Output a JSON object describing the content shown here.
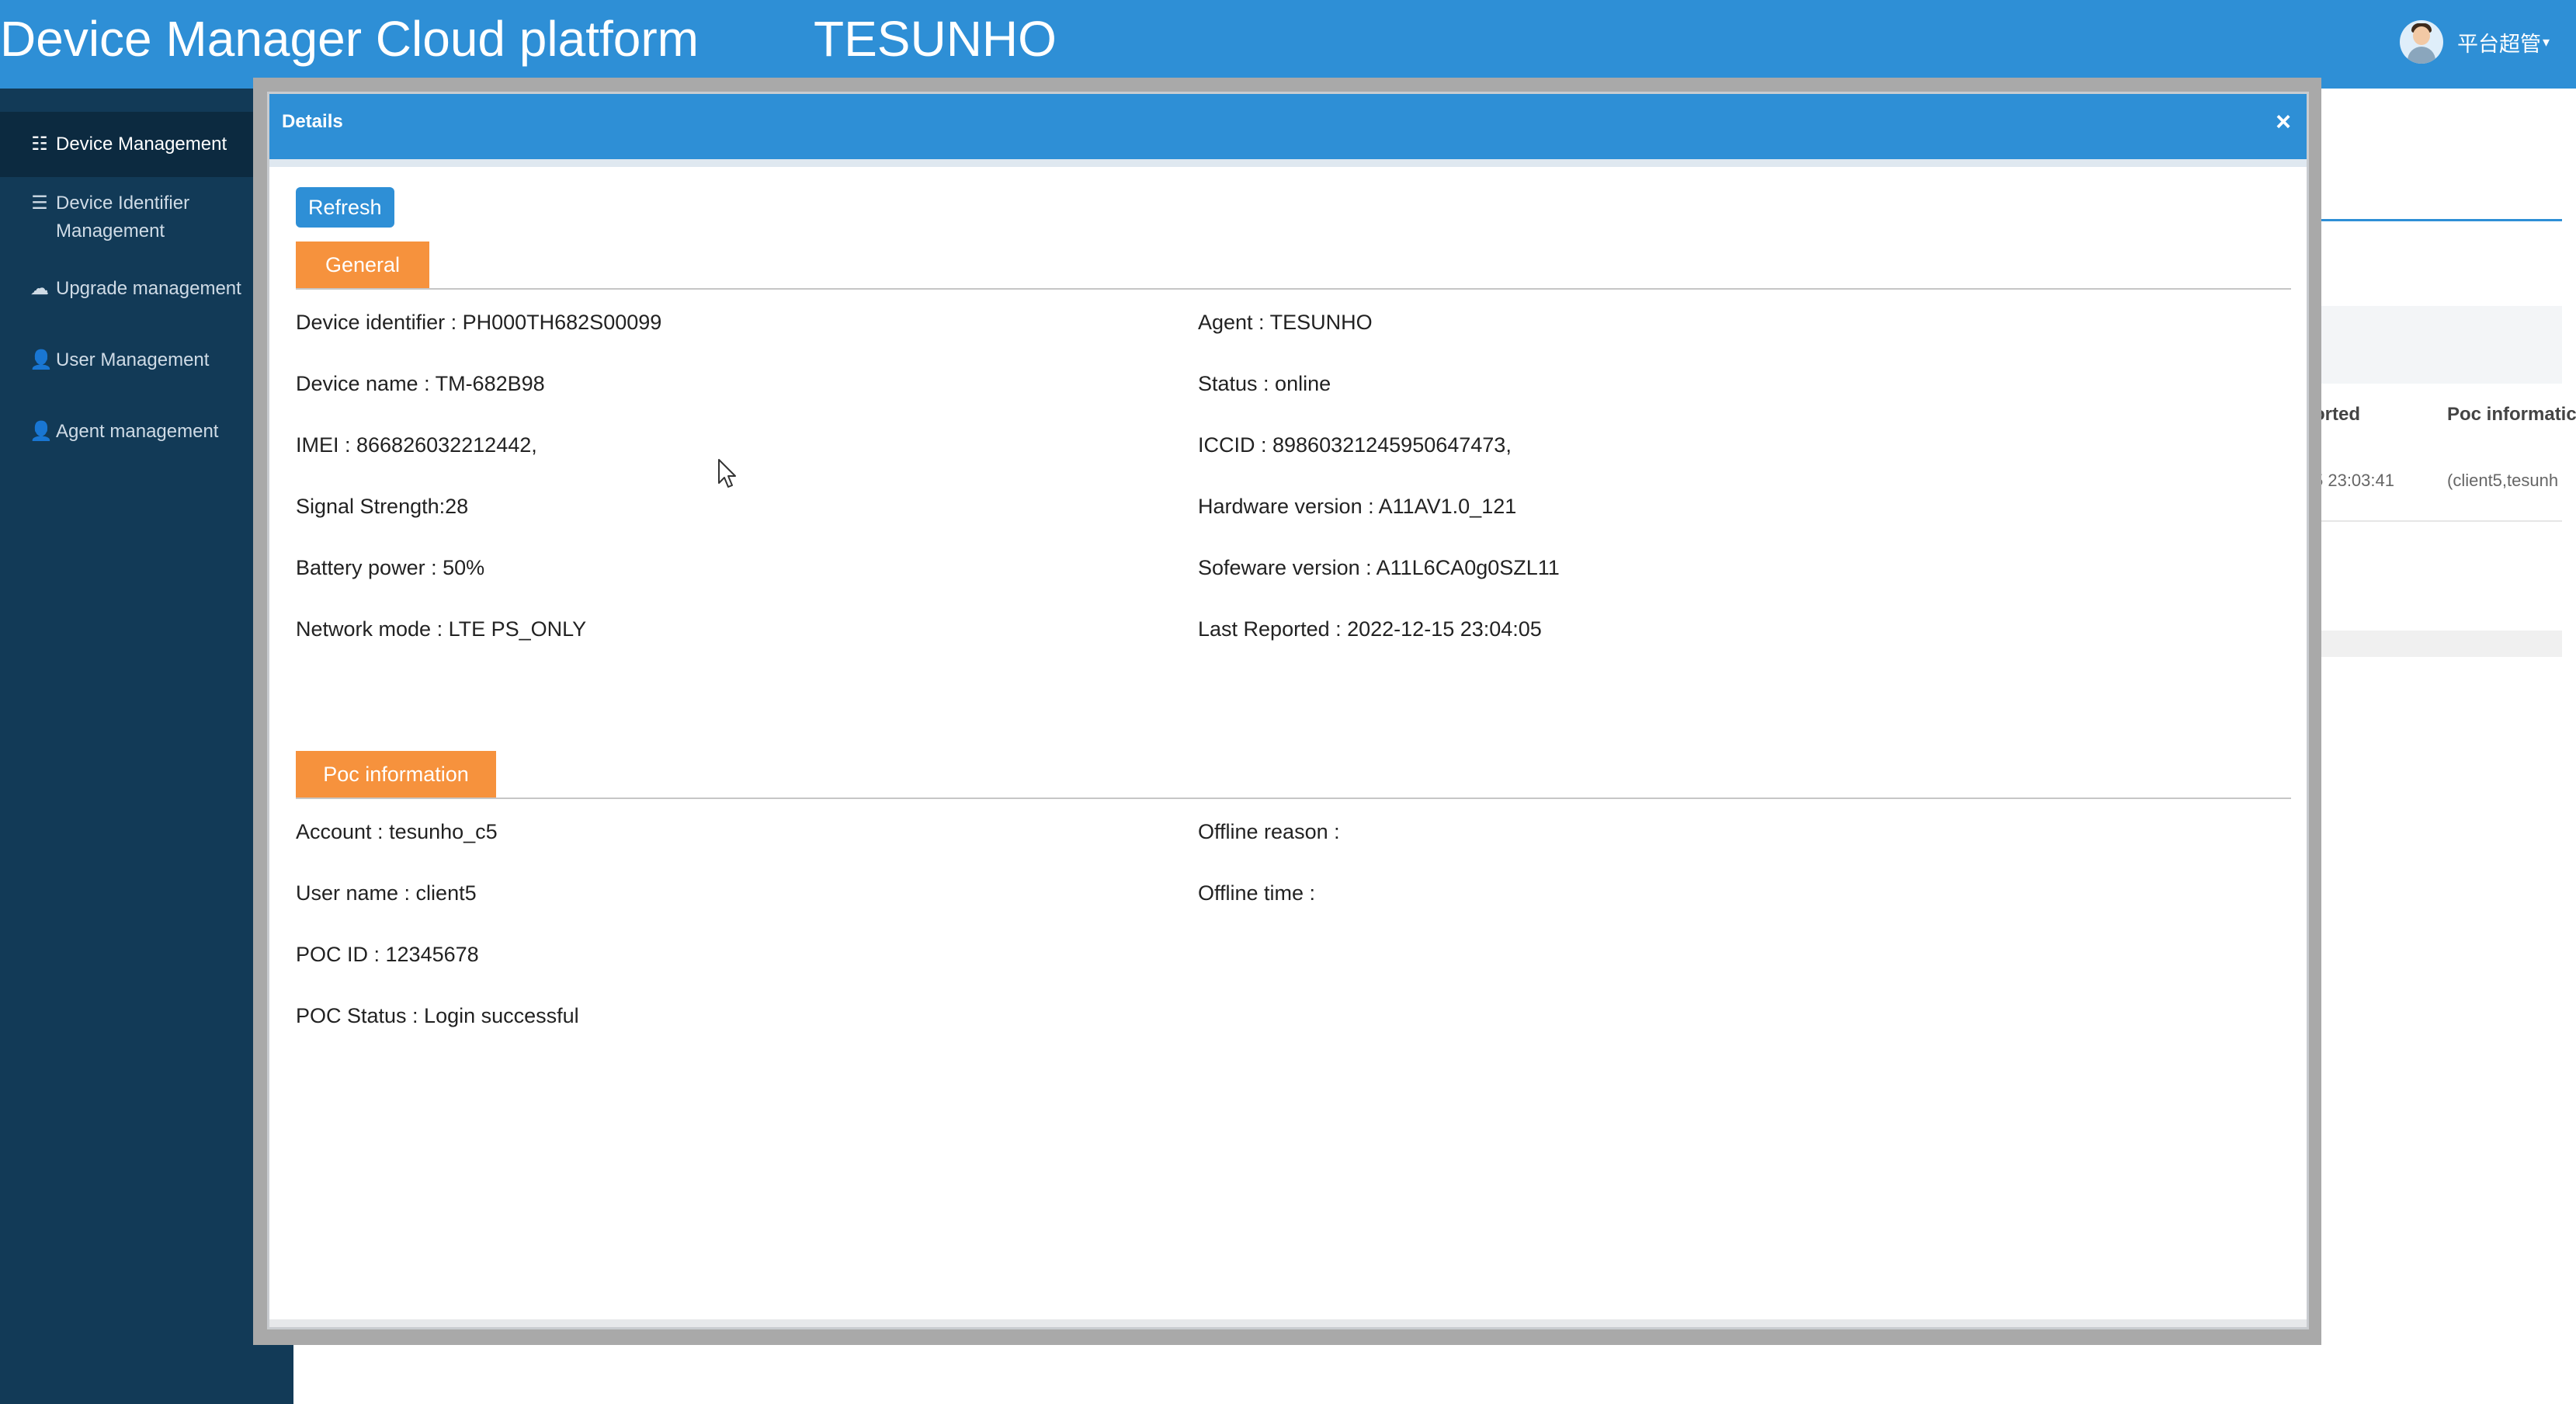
{
  "header": {
    "app_title": "Device Manager Cloud platform",
    "brand": "TESUNHO",
    "user_label": "平台超管",
    "user_caret": "▾"
  },
  "sidebar": {
    "items": [
      {
        "label": "Device Management",
        "icon": "grid-icon",
        "glyph": "☷",
        "active": true
      },
      {
        "label": "Device Identifier Management",
        "icon": "list-icon",
        "glyph": "☰",
        "active": false
      },
      {
        "label": "Upgrade management",
        "icon": "cloud-upload-icon",
        "glyph": "☁",
        "active": false
      },
      {
        "label": "User Management",
        "icon": "user-icon",
        "glyph": "👤",
        "active": false
      },
      {
        "label": "Agent management",
        "icon": "user-icon",
        "glyph": "👤",
        "active": false
      }
    ]
  },
  "background": {
    "column_reported": "orted",
    "column_poc": "Poc informatic",
    "cell_time": "5 23:03:41",
    "cell_poc": "(client5,tesunh"
  },
  "modal": {
    "title": "Details",
    "close_glyph": "×",
    "refresh_label": "Refresh",
    "general": {
      "tab_label": "General",
      "left": [
        "Device identifier : PH000TH682S00099",
        "Device name : TM-682B98",
        "IMEI : 866826032212442,",
        "Signal Strength:28",
        "Battery power : 50%",
        "Network mode : LTE PS_ONLY"
      ],
      "right": [
        "Agent : TESUNHO",
        "Status : online",
        "ICCID : 89860321245950647473,",
        "Hardware version : A11AV1.0_121",
        "Sofeware version : A11L6CA0g0SZL11",
        "Last Reported : 2022-12-15 23:04:05"
      ]
    },
    "poc": {
      "tab_label": "Poc information",
      "left": [
        "Account : tesunho_c5",
        "User name : client5",
        "POC ID : 12345678",
        "POC Status : Login successful"
      ],
      "right": [
        "Offline reason :",
        "Offline time :"
      ]
    }
  }
}
